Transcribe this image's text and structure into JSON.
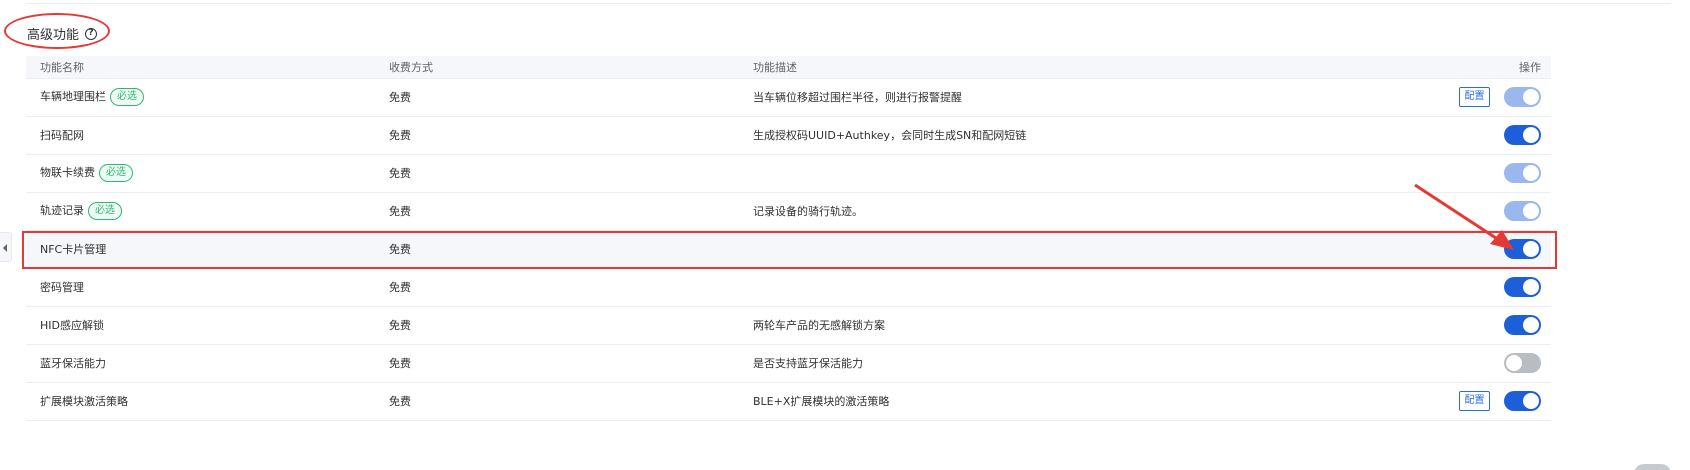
{
  "section": {
    "title": "高级功能",
    "help_icon": "question-circle-icon"
  },
  "table": {
    "columns": {
      "name": "功能名称",
      "billing": "收费方式",
      "description": "功能描述",
      "operation": "操作"
    },
    "rows": [
      {
        "name": "车辆地理围栏",
        "required": "必选",
        "billing": "免费",
        "description": "当车辆位移超过围栏半径，则进行报警提醒",
        "config": "配置",
        "switch_state": "on-disabled"
      },
      {
        "name": "扫码配网",
        "required": "",
        "billing": "免费",
        "description": "生成授权码UUID+Authkey，会同时生成SN和配网短链",
        "config": "",
        "switch_state": "on"
      },
      {
        "name": "物联卡续费",
        "required": "必选",
        "billing": "免费",
        "description": "",
        "config": "",
        "switch_state": "on-disabled"
      },
      {
        "name": "轨迹记录",
        "required": "必选",
        "billing": "免费",
        "description": "记录设备的骑行轨迹。",
        "config": "",
        "switch_state": "on-disabled"
      },
      {
        "name": "NFC卡片管理",
        "required": "",
        "billing": "免费",
        "description": "",
        "config": "",
        "switch_state": "on"
      },
      {
        "name": "密码管理",
        "required": "",
        "billing": "免费",
        "description": "",
        "config": "",
        "switch_state": "on"
      },
      {
        "name": "HID感应解锁",
        "required": "",
        "billing": "免费",
        "description": "两轮车产品的无感解锁方案",
        "config": "",
        "switch_state": "on"
      },
      {
        "name": "蓝牙保活能力",
        "required": "",
        "billing": "免费",
        "description": "是否支持蓝牙保活能力",
        "config": "",
        "switch_state": "off"
      },
      {
        "name": "扩展模块激活策略",
        "required": "",
        "billing": "免费",
        "description": "BLE+X扩展模块的激活策略",
        "config": "配置",
        "switch_state": "on"
      }
    ]
  },
  "annotation_colors": {
    "red": "#e53935"
  },
  "colors": {
    "switch_on": "#1d5fd8",
    "switch_disabled": "#9ab8ee",
    "switch_off": "#b9bcc2",
    "required_tag": "#2eb872"
  }
}
